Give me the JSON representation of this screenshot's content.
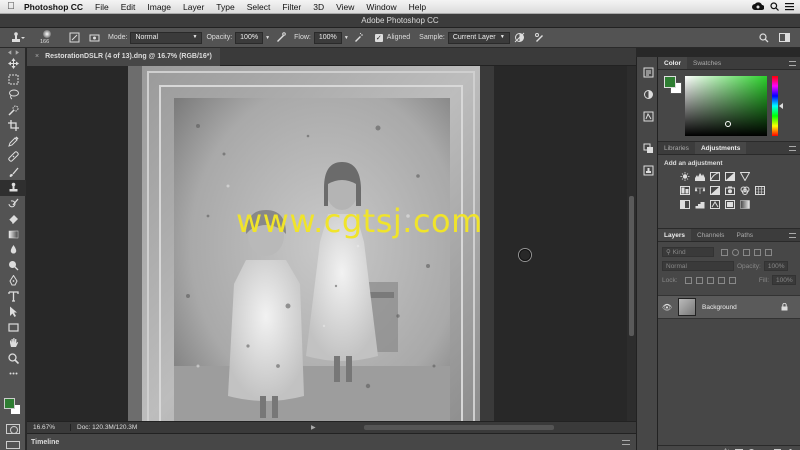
{
  "menubar": {
    "app_name": "Photoshop CC",
    "items": [
      "File",
      "Edit",
      "Image",
      "Layer",
      "Type",
      "Select",
      "Filter",
      "3D",
      "View",
      "Window",
      "Help"
    ]
  },
  "window": {
    "title": "Adobe Photoshop CC"
  },
  "options": {
    "brush_size": "166",
    "mode_label": "Mode:",
    "mode_value": "Normal",
    "opacity_label": "Opacity:",
    "opacity_value": "100%",
    "flow_label": "Flow:",
    "flow_value": "100%",
    "aligned_label": "Aligned",
    "sample_label": "Sample:",
    "sample_value": "Current Layer"
  },
  "document": {
    "tab_title": "RestorationDSLR (4 of 13).dng @ 16.7% (RGB/16*)",
    "zoom": "16.67%",
    "doc_info": "Doc: 120.3M/120.3M",
    "watermark": "www.cgtsj.com"
  },
  "timeline": {
    "label": "Timeline"
  },
  "color_panel": {
    "tabs": [
      "Color",
      "Swatches"
    ],
    "foreground": "#2e7d32",
    "background": "#ffffff"
  },
  "adjust_panel": {
    "tabs": [
      "Libraries",
      "Adjustments"
    ],
    "heading": "Add an adjustment"
  },
  "layers_panel": {
    "tabs": [
      "Layers",
      "Channels",
      "Paths"
    ],
    "filter_kind": "Kind",
    "blend_mode": "Normal",
    "opacity_label": "Opacity:",
    "opacity_value": "100%",
    "lock_label": "Lock:",
    "fill_label": "Fill:",
    "fill_value": "100%",
    "layers": [
      {
        "name": "Background"
      }
    ]
  },
  "colors": {
    "accent_watermark": "#f0e42a",
    "panel_bg": "#474747",
    "toolbar_bg": "#535353"
  }
}
